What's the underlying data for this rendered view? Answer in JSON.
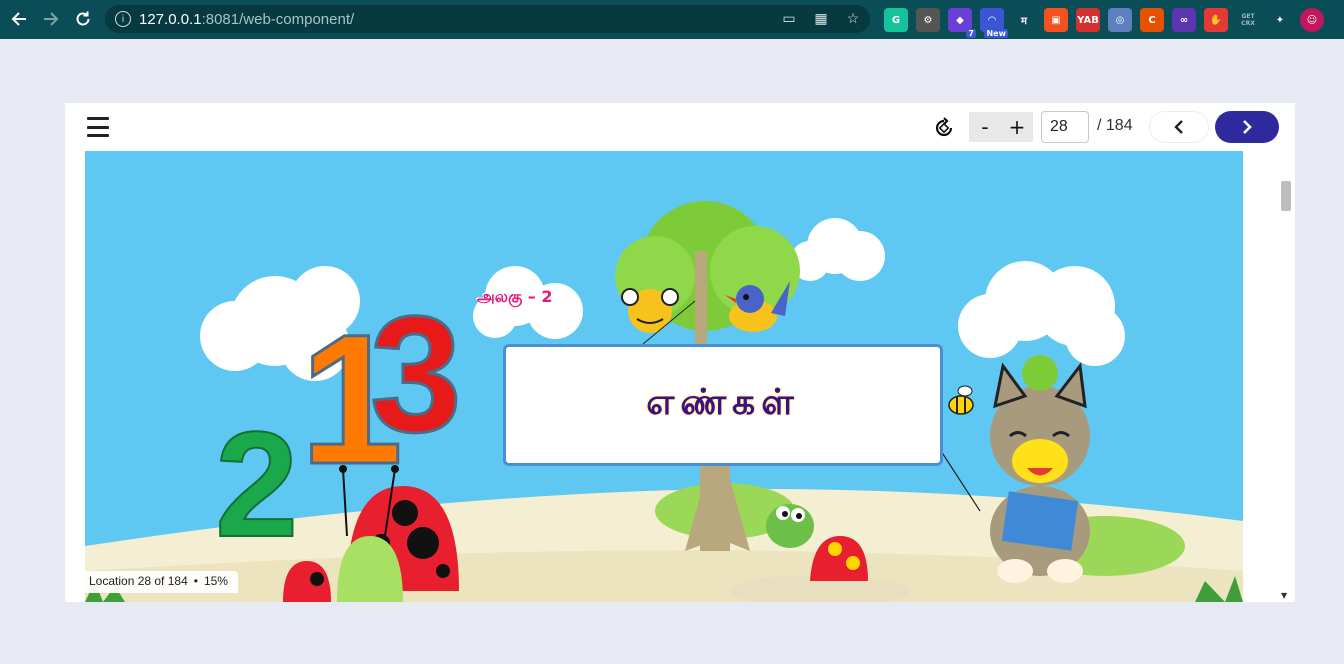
{
  "browser": {
    "url_host": "127.0.0.1",
    "url_path": ":8081/web-component/",
    "extensions": [
      {
        "name": "grammarly-icon",
        "color": "#15c39a",
        "label": "G"
      },
      {
        "name": "gear-ext-icon",
        "color": "#555555",
        "label": "⚙"
      },
      {
        "name": "purple-ext-icon",
        "color": "#6b3fd6",
        "label": "◆",
        "badge": "7"
      },
      {
        "name": "rainbow-ext-icon",
        "color": "#3a56d4",
        "label": "◠",
        "badge": "New"
      },
      {
        "name": "hindi-ext-icon",
        "color": "#0b4d57",
        "label": "म"
      },
      {
        "name": "orange-ext-icon",
        "color": "#f4511e",
        "label": "▣"
      },
      {
        "name": "yab-ext-icon",
        "color": "#d32f2f",
        "label": "YAB"
      },
      {
        "name": "circle-ext-icon",
        "color": "#5b7fbf",
        "label": "◎"
      },
      {
        "name": "c-ext-icon",
        "color": "#e65100",
        "label": "C"
      },
      {
        "name": "link-ext-icon",
        "color": "#5e35b1",
        "label": "∞"
      },
      {
        "name": "hand-ext-icon",
        "color": "#e53935",
        "label": "✋"
      },
      {
        "name": "getcrx-ext-icon",
        "color": "#0b4d57",
        "label": "GET CRX"
      },
      {
        "name": "puzzle-icon",
        "color": "#0b4d57",
        "label": "✦"
      },
      {
        "name": "profile-avatar",
        "color": "#c2185b",
        "label": "☺"
      }
    ]
  },
  "reader": {
    "zoom_out_label": "-",
    "zoom_in_label": "+",
    "current_page": "28",
    "total_pages": "/ 184",
    "prev_label": "<",
    "next_label": ">",
    "status_location": "Location 28 of 184",
    "status_separator": "•",
    "status_percent": "15%"
  },
  "page_content": {
    "unit_label": "அலகு – 2",
    "title": "எண்கள்",
    "numbers": [
      "2",
      "1",
      "3"
    ],
    "colors": {
      "sky": "#5ec7f2",
      "banner_border": "#4a8fd6",
      "number_green": "#1aa84a",
      "number_orange": "#ff7a00",
      "number_red": "#e81919",
      "accent_blue": "#2e2a9e"
    }
  }
}
